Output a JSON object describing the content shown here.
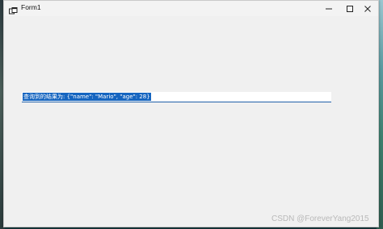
{
  "window": {
    "title": "Form1",
    "controls": {
      "minimize": "minimize",
      "maximize": "maximize",
      "close": "close"
    }
  },
  "main": {
    "result_text": "查询到的结果为: {\"name\": \"Mario\", \"age\": 28}"
  },
  "watermark": "CSDN @ForeverYang2015",
  "colors": {
    "accent": "#1565c0",
    "window_bg": "#f0f0f0"
  }
}
